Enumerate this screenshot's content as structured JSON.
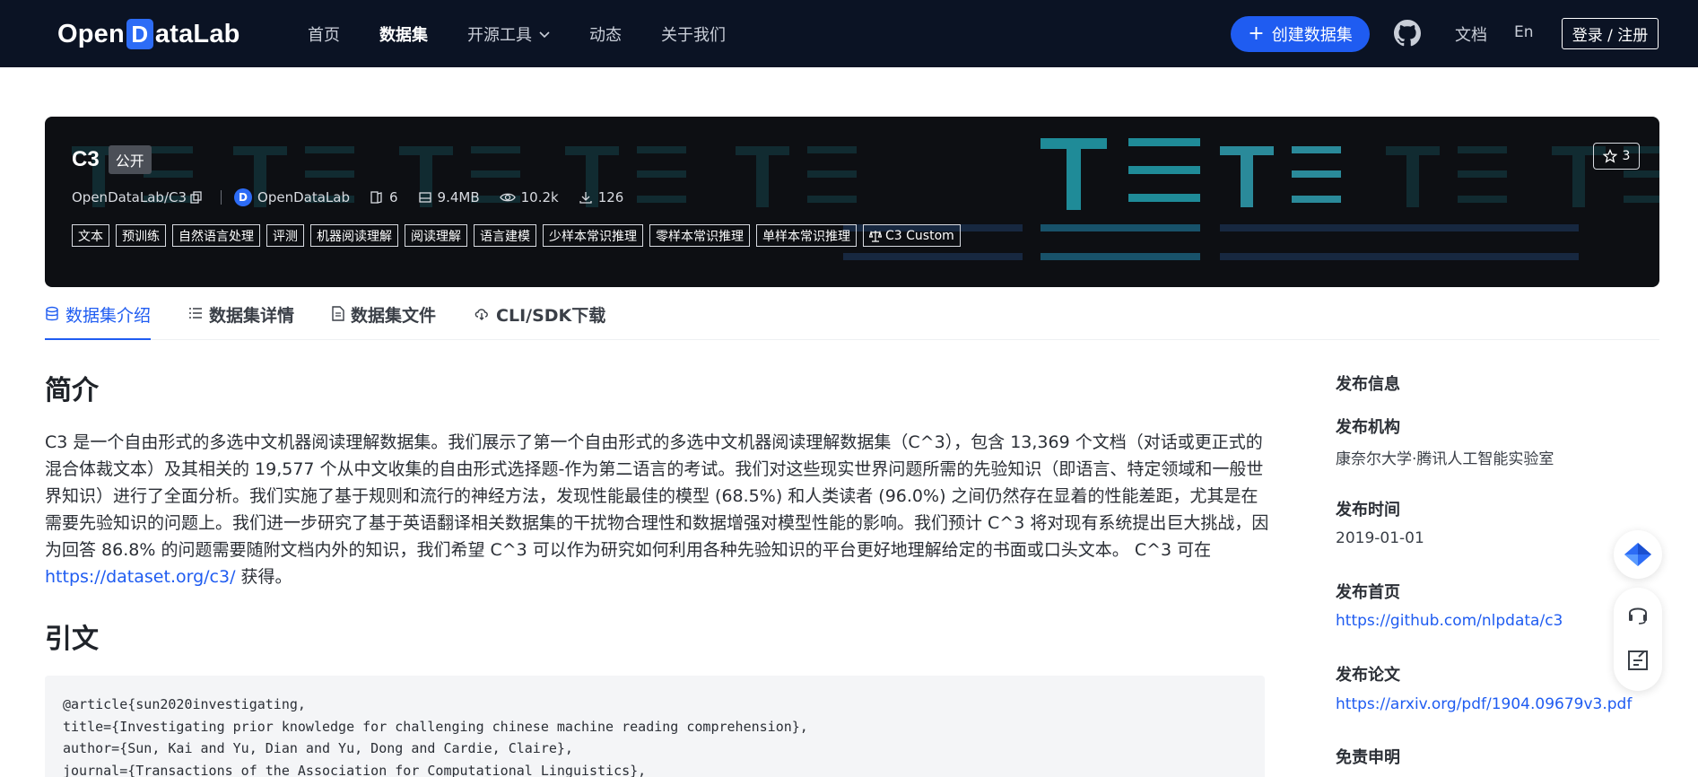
{
  "nav": {
    "logo_left": "Open",
    "logo_d": "D",
    "logo_right": "ataLab",
    "items": [
      {
        "label": "首页"
      },
      {
        "label": "数据集"
      },
      {
        "label": "开源工具"
      },
      {
        "label": "动态"
      },
      {
        "label": "关于我们"
      }
    ],
    "create_label": "创建数据集",
    "docs_label": "文档",
    "lang_label": "En",
    "login_label": "登录 / 注册"
  },
  "dataset": {
    "name": "C3",
    "visibility": "公开",
    "path": "OpenDataLab/C3",
    "org": "OpenDataLab",
    "files": "6",
    "size": "9.4MB",
    "views": "10.2k",
    "downloads": "126",
    "stars": "3",
    "tags": [
      "文本",
      "预训练",
      "自然语言处理",
      "评测",
      "机器阅读理解",
      "阅读理解",
      "语言建模",
      "少样本常识推理",
      "零样本常识推理",
      "单样本常识推理",
      "C3 Custom"
    ]
  },
  "tabs": [
    {
      "label": "数据集介绍"
    },
    {
      "label": "数据集详情"
    },
    {
      "label": "数据集文件"
    },
    {
      "label": "CLI/SDK下载"
    }
  ],
  "intro": {
    "heading": "简介",
    "text_before_link": "C3 是一个自由形式的多选中文机器阅读理解数据集。我们展示了第一个自由形式的多选中文机器阅读理解数据集（C^3），包含 13,369 个文档（对话或更正式的混合体裁文本）及其相关的 19,577 个从中文收集的自由形式选择题-作为第二语言的考试。我们对这些现实世界问题所需的先验知识（即语言、特定领域和一般世界知识）进行了全面分析。我们实施了基于规则和流行的神经方法，发现性能最佳的模型 (68.5%) 和人类读者 (96.0%) 之间仍然存在显着的性能差距，尤其是在需要先验知识的问题上。我们进一步研究了基于英语翻译相关数据集的干扰物合理性和数据增强对模型性能的影响。我们预计 C^3 将对现有系统提出巨大挑战，因为回答 86.8% 的问题需要随附文档内外的知识，我们希望 C^3 可以作为研究如何利用各种先验知识的平台更好地理解给定的书面或口头文本。 C^3 可在 ",
    "link": "https://dataset.org/c3/",
    "text_after_link": " 获得。"
  },
  "citation": {
    "heading": "引文",
    "lines": [
      "@article{sun2020investigating,",
      "title={Investigating prior knowledge for challenging chinese machine reading comprehension},",
      "author={Sun, Kai and Yu, Dian and Yu, Dong and Cardie, Claire},",
      "journal={Transactions of the Association for Computational Linguistics},"
    ]
  },
  "sidebar": {
    "heading": "发布信息",
    "org_label": "发布机构",
    "org_value": "康奈尔大学·腾讯人工智能实验室",
    "date_label": "发布时间",
    "date_value": "2019-01-01",
    "home_label": "发布首页",
    "home_value": "https://github.com/nlpdata/c3",
    "paper_label": "发布论文",
    "paper_value": "https://arxiv.org/pdf/1904.09679v3.pdf",
    "disclaimer_label": "免责申明"
  },
  "colors": {
    "nav_bg": "#0b1324",
    "accent": "#1f5cf1",
    "banner_bg": "#0d0f13",
    "banner_teal": "#1f8b98"
  }
}
